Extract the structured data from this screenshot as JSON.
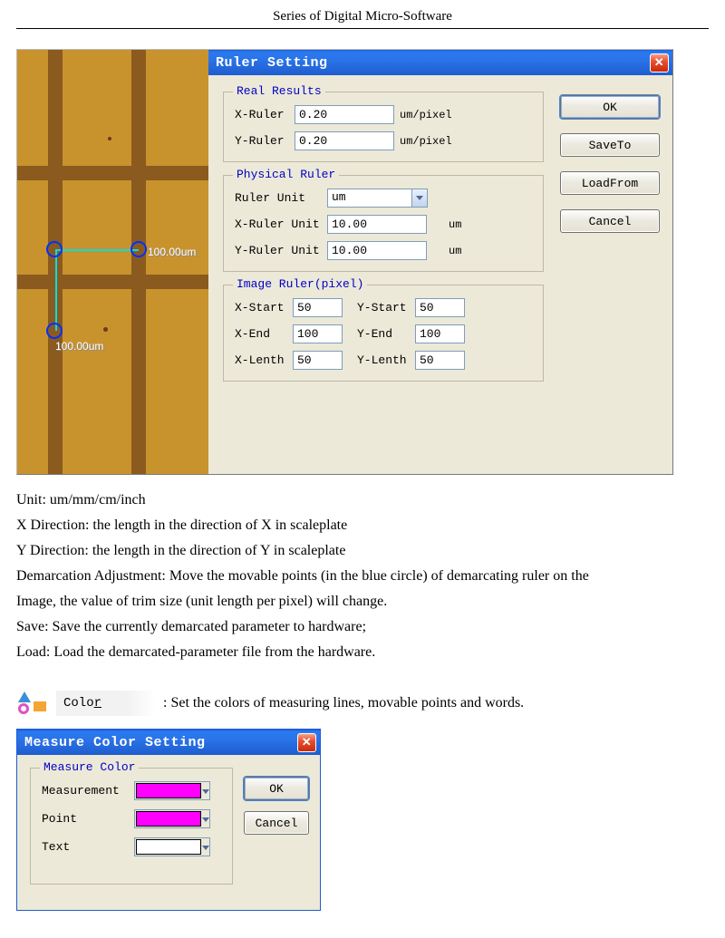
{
  "header": {
    "title": "Series of Digital Micro-Software"
  },
  "ruler_dialog": {
    "title": "Ruler Setting",
    "close_glyph": "✕",
    "real_results": {
      "legend": "Real Results",
      "x_label": "X-Ruler",
      "x_value": "0.20",
      "y_label": "Y-Ruler",
      "y_value": "0.20",
      "unit": "um/pixel"
    },
    "physical_ruler": {
      "legend": "Physical Ruler",
      "unit_label": "Ruler Unit",
      "unit_value": "um",
      "x_label": "X-Ruler Unit",
      "x_value": "10.00",
      "y_label": "Y-Ruler Unit",
      "y_value": "10.00",
      "unit_suffix": "um"
    },
    "image_ruler": {
      "legend": "Image Ruler(pixel)",
      "xstart_label": "X-Start",
      "xstart_value": "50",
      "ystart_label": "Y-Start",
      "ystart_value": "50",
      "xend_label": "X-End",
      "xend_value": "100",
      "yend_label": "Y-End",
      "yend_value": "100",
      "xlen_label": "X-Lenth",
      "xlen_value": "50",
      "ylen_label": "Y-Lenth",
      "ylen_value": "50"
    },
    "buttons": {
      "ok": "OK",
      "saveto": "SaveTo",
      "loadfrom": "LoadFrom",
      "cancel": "Cancel"
    },
    "measurements": {
      "h": "100.00um",
      "v": "100.00um"
    }
  },
  "body_text": {
    "l1": "Unit: um/mm/cm/inch",
    "l2": "X Direction: the length in the direction of X in scaleplate",
    "l3": "Y Direction: the length in the direction of Y in scaleplate",
    "l4": "Demarcation Adjustment: Move the movable points (in the blue circle) of demarcating ruler on the",
    "l5": "Image, the value of trim size (unit length per pixel) will change.",
    "l6": "Save: Save the currently demarcated parameter to hardware;",
    "l7": "Load: Load the demarcated-parameter file from the hardware."
  },
  "color_item": {
    "label": "Color",
    "desc": ": Set the colors of measuring lines, movable points and words."
  },
  "measure_color_dialog": {
    "title": "Measure Color Setting",
    "legend": "Measure Color",
    "measurement_label": "Measurement",
    "point_label": "Point",
    "text_label": "Text",
    "ok": "OK",
    "cancel": "Cancel",
    "close_glyph": "✕",
    "measurement_color": "#ff00ff",
    "point_color": "#ff00ff",
    "text_color": "#ffffff"
  }
}
